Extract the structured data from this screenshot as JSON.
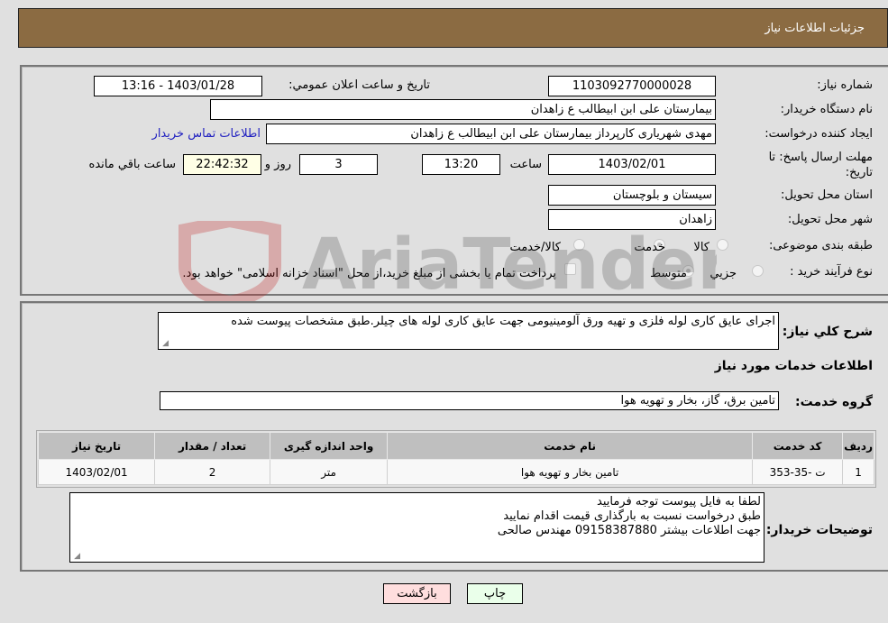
{
  "header": {
    "title": "جزئیات اطلاعات نیاز"
  },
  "details": {
    "need_number_label": "شماره نیاز:",
    "need_number": "1103092770000028",
    "announce_label": "تاریخ و ساعت اعلان عمومي:",
    "announce_value": "1403/01/28 - 13:16",
    "buyer_org_label": "نام دستگاه خریدار:",
    "buyer_org": "بیمارستان علی ابن ابیطالب  ع  زاهدان",
    "creator_label": "ایجاد کننده درخواست:",
    "creator": "مهدی شهریاری کارپرداز بیمارستان علی ابن ابیطالب  ع  زاهدان",
    "buyer_contact_link": "اطلاعات تماس خریدار",
    "deadline_label": "مهلت ارسال پاسخ: تا تاریخ:",
    "deadline_date": "1403/02/01",
    "time_label": "ساعت",
    "deadline_time": "13:20",
    "days_value": "3",
    "days_label": "روز و",
    "remaining_time": "22:42:32",
    "remaining_label": "ساعت باقي مانده",
    "province_label": "استان محل تحویل:",
    "province": "سیستان و بلوچستان",
    "city_label": "شهر محل تحویل:",
    "city": "زاهدان",
    "category_label": "طبقه بندی موضوعی:",
    "category_options": [
      "کالا",
      "خدمت",
      "کالا/خدمت"
    ],
    "category_selected": "خدمت",
    "process_label": "نوع فرآیند خرید :",
    "process_options": [
      "جزيي",
      "متوسط"
    ],
    "process_selected": "متوسط",
    "treasury_note": "پرداخت تمام یا بخشی از مبلغ خرید،از محل \"اسناد خزانه اسلامی\" خواهد بود."
  },
  "description": {
    "label": "شرح کلي نیاز:",
    "text": "اجرای عایق کاری لوله فلزی و تهیه ورق آلومینیومی جهت عایق کاری لوله های چیلر.طبق مشخصات پیوست شده"
  },
  "services": {
    "section_title": "اطلاعات خدمات مورد نیاز",
    "group_label": "گروه خدمت:",
    "group_value": "تامین برق، گاز، بخار و تهویه هوا",
    "table": {
      "headers": [
        "ردیف",
        "کد خدمت",
        "نام خدمت",
        "واحد اندازه گیری",
        "تعداد / مقدار",
        "تاریخ نیاز"
      ],
      "rows": [
        [
          "1",
          "ت -35-353",
          "تامین بخار و تهویه هوا",
          "متر",
          "2",
          "1403/02/01"
        ]
      ]
    }
  },
  "buyer_notes": {
    "label": "توضیحات خریدار:",
    "lines": [
      "لطفا به فایل پیوست توجه فرمایید",
      "طبق درخواست نسبت به بارگذاری قیمت اقدام نمایید",
      "جهت اطلاعات بیشتر 09158387880 مهندس صالحی"
    ]
  },
  "buttons": {
    "print": "چاپ",
    "back": "بازگشت"
  },
  "colors": {
    "header_bg": "#8b6b42",
    "print_bg": "#eaffea",
    "back_bg": "#ffdede",
    "remaining_bg": "#ffffe6",
    "link": "#2020c0"
  }
}
